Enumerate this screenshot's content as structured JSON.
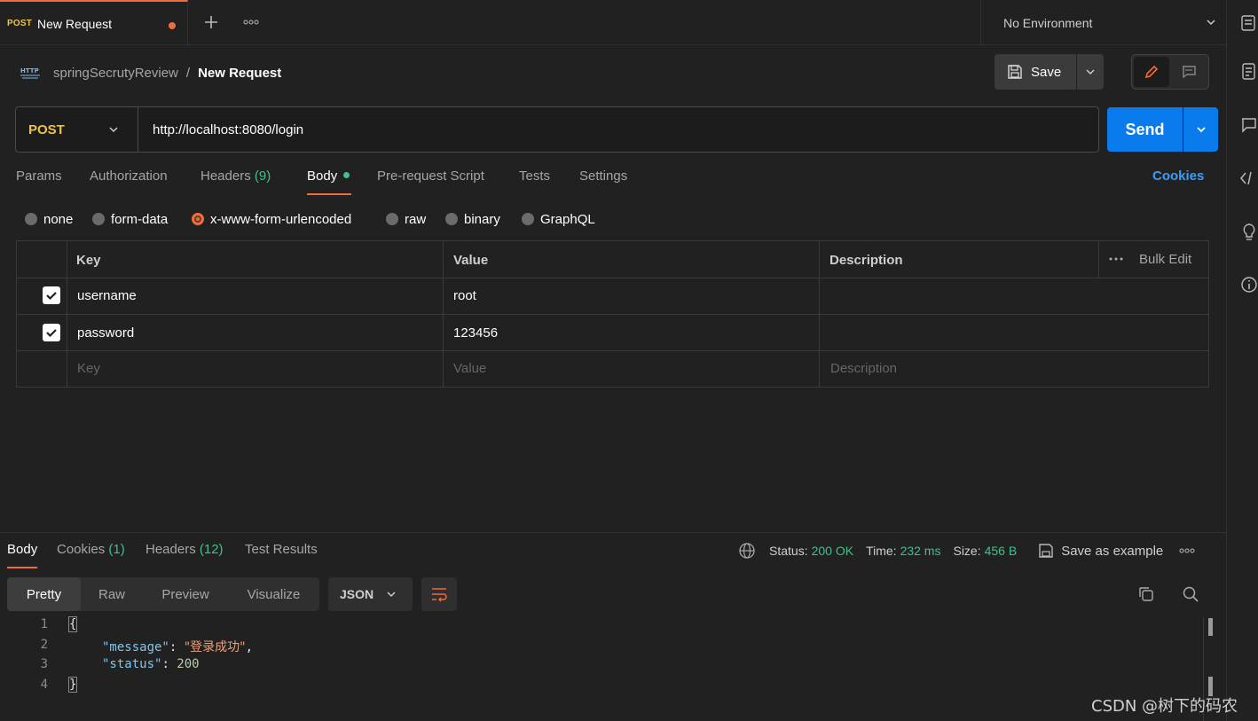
{
  "tab": {
    "method": "POST",
    "title": "New Request"
  },
  "toolbar": {
    "environment": "No Environment"
  },
  "breadcrumb": {
    "collection": "springSecrutyReview",
    "separator": "/",
    "request": "New Request",
    "icon": "http-icon"
  },
  "actions": {
    "save_label": "Save"
  },
  "request": {
    "method": "POST",
    "url": "http://localhost:8080/login",
    "send_label": "Send"
  },
  "request_tabs": {
    "params": "Params",
    "authorization": "Authorization",
    "headers": "Headers",
    "headers_count": "(9)",
    "body": "Body",
    "prerequest": "Pre-request Script",
    "tests": "Tests",
    "settings": "Settings",
    "cookies": "Cookies"
  },
  "body_types": {
    "none": "none",
    "form_data": "form-data",
    "urlencoded": "x-www-form-urlencoded",
    "raw": "raw",
    "binary": "binary",
    "graphql": "GraphQL",
    "selected": "x-www-form-urlencoded"
  },
  "table": {
    "headers": {
      "key": "Key",
      "value": "Value",
      "description": "Description",
      "bulk_edit": "Bulk Edit"
    },
    "rows": [
      {
        "checked": true,
        "key": "username",
        "value": "root",
        "description": ""
      },
      {
        "checked": true,
        "key": "password",
        "value": "123456",
        "description": ""
      }
    ],
    "placeholders": {
      "key": "Key",
      "value": "Value",
      "description": "Description"
    }
  },
  "response_tabs": {
    "body": "Body",
    "cookies": "Cookies",
    "cookies_count": "(1)",
    "headers": "Headers",
    "headers_count": "(12)",
    "tests": "Test Results"
  },
  "response_meta": {
    "status_label": "Status:",
    "status_value": "200 OK",
    "time_label": "Time:",
    "time_value": "232 ms",
    "size_label": "Size:",
    "size_value": "456 B",
    "save_example": "Save as example"
  },
  "view_modes": {
    "pretty": "Pretty",
    "raw": "Raw",
    "preview": "Preview",
    "visualize": "Visualize",
    "format": "JSON"
  },
  "response_body": {
    "line_numbers": [
      "1",
      "2",
      "3",
      "4"
    ],
    "open_brace": "{",
    "close_brace": "}",
    "message_key": "\"message\"",
    "message_value": "\"登录成功\"",
    "status_key": "\"status\"",
    "status_value": "200"
  },
  "watermark": "CSDN @树下的码农",
  "colors": {
    "accent": "#f26b3a",
    "send": "#097bed",
    "method": "#f0c440",
    "success": "#3dc28a",
    "link": "#3d9cf5"
  }
}
